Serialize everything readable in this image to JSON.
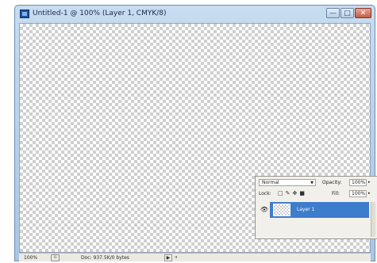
{
  "window": {
    "title": "Untitled-1 @ 100% (Layer 1, CMYK/8)",
    "controls": {
      "minimize": "—",
      "maximize": "□",
      "close": "✕"
    }
  },
  "statusbar": {
    "zoom": "100%",
    "doc_size": "Doc: 937.5K/0 bytes",
    "play_glyph": "▶",
    "scroll_glyph": "◂"
  },
  "layers_panel": {
    "blend_mode": "Normal",
    "opacity_label": "Opacity:",
    "opacity_value": "100%",
    "lock_label": "Lock:",
    "fill_label": "Fill:",
    "fill_value": "100%",
    "layers": [
      {
        "name": "Layer 1",
        "visible": true,
        "selected": true
      }
    ]
  },
  "colors": {
    "selection": "#3d7dcb",
    "titlebar": "#b9d1ea"
  }
}
